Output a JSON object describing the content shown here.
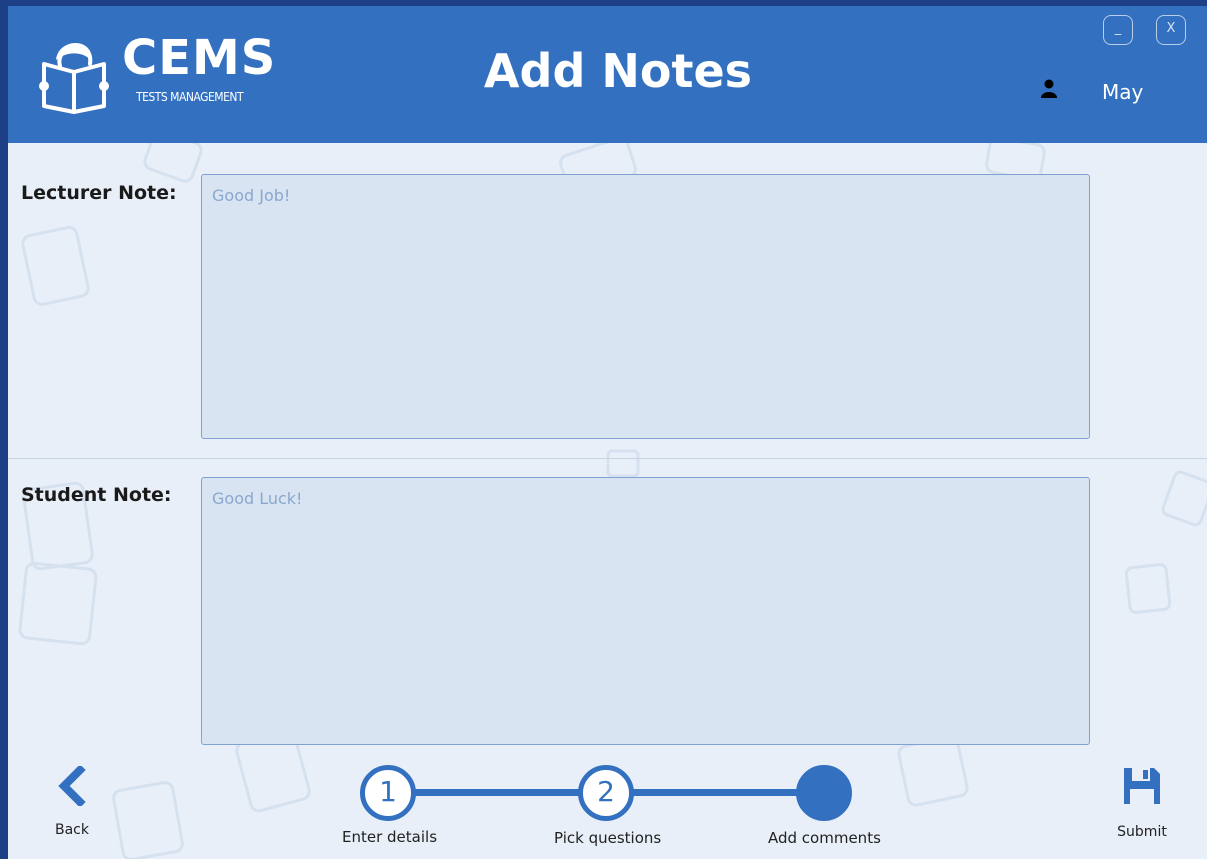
{
  "header": {
    "app_name": "CEMS",
    "app_subtitle": "TESTS MANAGEMENT",
    "title": "Add Notes",
    "user_name": "May",
    "minimize_label": "_",
    "close_label": "X"
  },
  "form": {
    "lecturer_label": "Lecturer Note:",
    "lecturer_placeholder": "Good Job!",
    "lecturer_value": "",
    "student_label": "Student Note:",
    "student_placeholder": "Good Luck!",
    "student_value": ""
  },
  "footer": {
    "back_label": "Back",
    "submit_label": "Submit",
    "steps": [
      {
        "number": "1",
        "label": "Enter details",
        "state": "done"
      },
      {
        "number": "2",
        "label": "Pick questions",
        "state": "done"
      },
      {
        "number": "",
        "label": "Add comments",
        "state": "current"
      }
    ]
  },
  "icons": {
    "logo": "reader-book-icon",
    "user": "person-icon",
    "back": "chevron-left-icon",
    "submit": "floppy-disk-icon"
  },
  "colors": {
    "header": "#3370c0",
    "background": "#e8eff8",
    "textarea": "#d9e4f2",
    "textarea_border": "#7fa1d4",
    "placeholder": "#8aa8cf",
    "accent": "#3370c0"
  }
}
